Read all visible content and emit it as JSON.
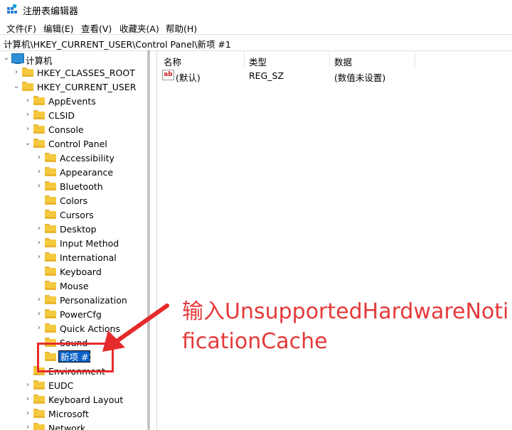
{
  "window": {
    "title": "注册表编辑器"
  },
  "menu": [
    "文件(F)",
    "编辑(E)",
    "查看(V)",
    "收藏夹(A)",
    "帮助(H)"
  ],
  "address": "计算机\\HKEY_CURRENT_USER\\Control Panel\\新项 #1",
  "tree": {
    "root": "计算机",
    "items": [
      {
        "label": "HKEY_CLASSES_ROOT"
      },
      {
        "label": "HKEY_CURRENT_USER"
      },
      {
        "label": "AppEvents"
      },
      {
        "label": "CLSID"
      },
      {
        "label": "Console"
      },
      {
        "label": "Control Panel"
      },
      {
        "label": "Accessibility"
      },
      {
        "label": "Appearance"
      },
      {
        "label": "Bluetooth"
      },
      {
        "label": "Colors"
      },
      {
        "label": "Cursors"
      },
      {
        "label": "Desktop"
      },
      {
        "label": "Input Method"
      },
      {
        "label": "International"
      },
      {
        "label": "Keyboard"
      },
      {
        "label": "Mouse"
      },
      {
        "label": "Personalization"
      },
      {
        "label": "PowerCfg"
      },
      {
        "label": "Quick Actions"
      },
      {
        "label": "Sound"
      },
      {
        "label": "新项 #1"
      },
      {
        "label": "Environment"
      },
      {
        "label": "EUDC"
      },
      {
        "label": "Keyboard Layout"
      },
      {
        "label": "Microsoft"
      },
      {
        "label": "Network"
      }
    ]
  },
  "list": {
    "columns": [
      "名称",
      "类型",
      "数据"
    ],
    "rows": [
      {
        "name": "(默认)",
        "type": "REG_SZ",
        "data": "(数值未设置)",
        "icon": "ab"
      }
    ]
  },
  "annotation": {
    "text": "输入UnsupportedHardwareNotificationCache",
    "color": "#e53a3a"
  },
  "colors": {
    "selection": "#0a62c9",
    "folder": "#f5c93e",
    "annotation": "#e52b2b"
  }
}
